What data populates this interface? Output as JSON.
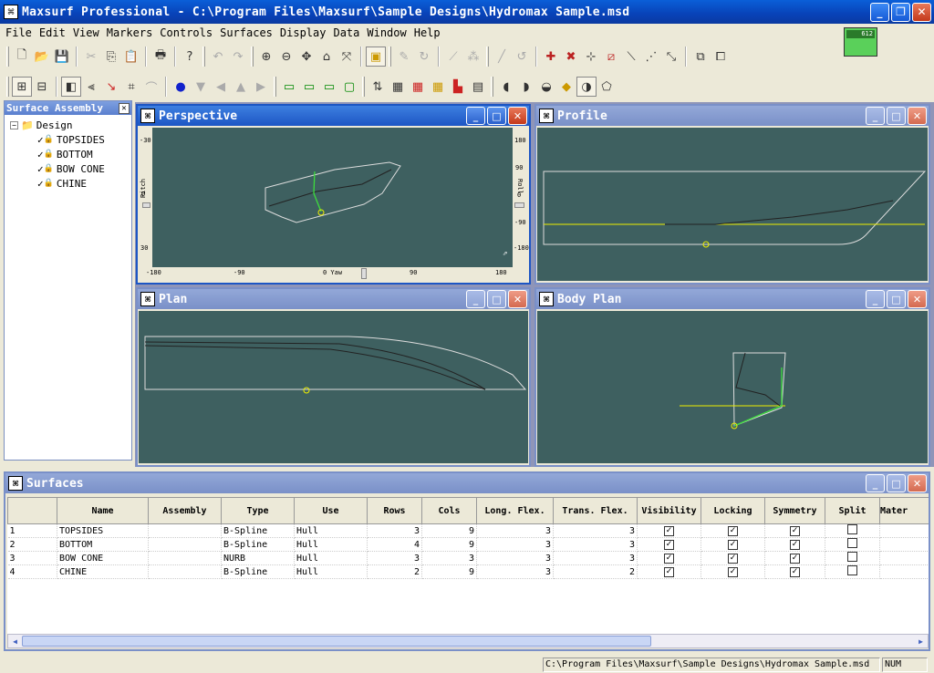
{
  "window": {
    "title": "Maxsurf Professional - C:\\Program Files\\Maxsurf\\Sample Designs\\Hydromax Sample.msd"
  },
  "menu": [
    "File",
    "Edit",
    "View",
    "Markers",
    "Controls",
    "Surfaces",
    "Display",
    "Data",
    "Window",
    "Help"
  ],
  "memory_widget": {
    "label": "612"
  },
  "surface_assembly": {
    "title": "Surface Assembly",
    "root": "Design",
    "items": [
      "TOPSIDES",
      "BOTTOM",
      "BOW CONE",
      "CHINE"
    ]
  },
  "views": {
    "perspective": {
      "title": "Perspective",
      "left_ticks": [
        "-30",
        "0",
        "30"
      ],
      "left_label": "Pitch",
      "right_ticks": [
        "180",
        "90",
        "0",
        "-90",
        "-180"
      ],
      "right_label": "Roll",
      "bottom_ticks": [
        "-180",
        "-90",
        "0 Yaw",
        "90",
        "180"
      ]
    },
    "profile": {
      "title": "Profile"
    },
    "plan": {
      "title": "Plan"
    },
    "body_plan": {
      "title": "Body Plan"
    }
  },
  "surfaces": {
    "title": "Surfaces",
    "columns": [
      "Name",
      "Assembly",
      "Type",
      "Use",
      "Rows",
      "Cols",
      "Long. Flex.",
      "Trans. Flex.",
      "Visibility",
      "Locking",
      "Symmetry",
      "Split",
      "Mater"
    ],
    "rows": [
      {
        "id": "1",
        "name": "TOPSIDES",
        "assembly": "",
        "type": "B-Spline",
        "use": "Hull",
        "rows": "3",
        "cols": "9",
        "long": "3",
        "trans": "3",
        "vis": true,
        "lock": true,
        "sym": true,
        "split": false
      },
      {
        "id": "2",
        "name": "BOTTOM",
        "assembly": "",
        "type": "B-Spline",
        "use": "Hull",
        "rows": "4",
        "cols": "9",
        "long": "3",
        "trans": "3",
        "vis": true,
        "lock": true,
        "sym": true,
        "split": false
      },
      {
        "id": "3",
        "name": "BOW CONE",
        "assembly": "",
        "type": "NURB",
        "use": "Hull",
        "rows": "3",
        "cols": "3",
        "long": "3",
        "trans": "3",
        "vis": true,
        "lock": true,
        "sym": true,
        "split": false
      },
      {
        "id": "4",
        "name": "CHINE",
        "assembly": "",
        "type": "B-Spline",
        "use": "Hull",
        "rows": "2",
        "cols": "9",
        "long": "3",
        "trans": "2",
        "vis": true,
        "lock": true,
        "sym": true,
        "split": false
      }
    ]
  },
  "status": {
    "path": "C:\\Program Files\\Maxsurf\\Sample Designs\\Hydromax Sample.msd",
    "num": "NUM"
  }
}
